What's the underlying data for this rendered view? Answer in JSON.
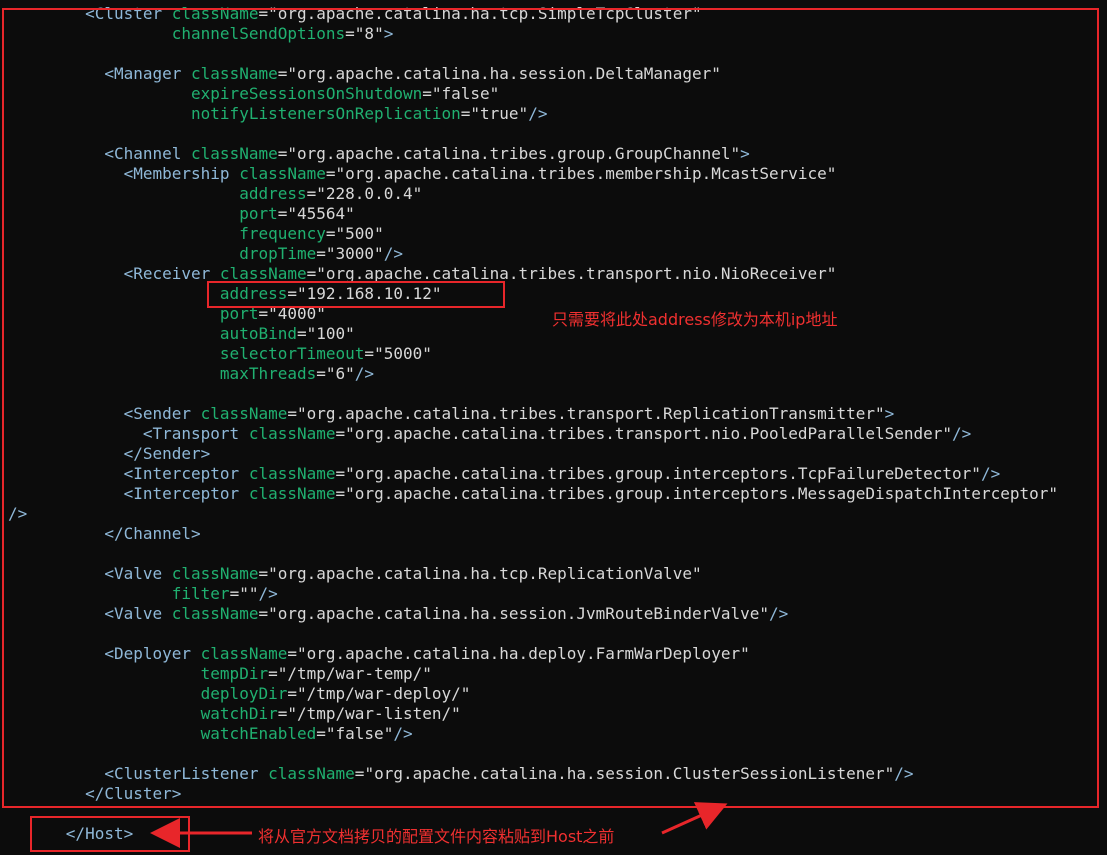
{
  "editor": {
    "lines": [
      [
        {
          "t": "tag",
          "s": "        <Cluster "
        },
        {
          "t": "attr",
          "s": "className"
        },
        {
          "t": "eq",
          "s": "="
        },
        {
          "t": "val",
          "s": "\"org.apache.catalina.ha.tcp.SimpleTcpCluster\""
        }
      ],
      [
        {
          "t": "attr",
          "s": "                 channelSendOptions"
        },
        {
          "t": "eq",
          "s": "="
        },
        {
          "t": "val",
          "s": "\"8\""
        },
        {
          "t": "tag",
          "s": ">"
        }
      ],
      [],
      [
        {
          "t": "tag",
          "s": "          <Manager "
        },
        {
          "t": "attr",
          "s": "className"
        },
        {
          "t": "eq",
          "s": "="
        },
        {
          "t": "val",
          "s": "\"org.apache.catalina.ha.session.DeltaManager\""
        }
      ],
      [
        {
          "t": "attr",
          "s": "                   expireSessionsOnShutdown"
        },
        {
          "t": "eq",
          "s": "="
        },
        {
          "t": "val",
          "s": "\"false\""
        }
      ],
      [
        {
          "t": "attr",
          "s": "                   notifyListenersOnReplication"
        },
        {
          "t": "eq",
          "s": "="
        },
        {
          "t": "val",
          "s": "\"true\""
        },
        {
          "t": "tag",
          "s": "/>"
        }
      ],
      [],
      [
        {
          "t": "tag",
          "s": "          <Channel "
        },
        {
          "t": "attr",
          "s": "className"
        },
        {
          "t": "eq",
          "s": "="
        },
        {
          "t": "val",
          "s": "\"org.apache.catalina.tribes.group.GroupChannel\""
        },
        {
          "t": "tag",
          "s": ">"
        }
      ],
      [
        {
          "t": "tag",
          "s": "            <Membership "
        },
        {
          "t": "attr",
          "s": "className"
        },
        {
          "t": "eq",
          "s": "="
        },
        {
          "t": "val",
          "s": "\"org.apache.catalina.tribes.membership.McastService\""
        }
      ],
      [
        {
          "t": "attr",
          "s": "                        address"
        },
        {
          "t": "eq",
          "s": "="
        },
        {
          "t": "val",
          "s": "\"228.0.0.4\""
        }
      ],
      [
        {
          "t": "attr",
          "s": "                        port"
        },
        {
          "t": "eq",
          "s": "="
        },
        {
          "t": "val",
          "s": "\"45564\""
        }
      ],
      [
        {
          "t": "attr",
          "s": "                        frequency"
        },
        {
          "t": "eq",
          "s": "="
        },
        {
          "t": "val",
          "s": "\"500\""
        }
      ],
      [
        {
          "t": "attr",
          "s": "                        dropTime"
        },
        {
          "t": "eq",
          "s": "="
        },
        {
          "t": "val",
          "s": "\"3000\""
        },
        {
          "t": "tag",
          "s": "/>"
        }
      ],
      [
        {
          "t": "tag",
          "s": "            <Receiver "
        },
        {
          "t": "attr",
          "s": "className"
        },
        {
          "t": "eq",
          "s": "="
        },
        {
          "t": "val",
          "s": "\"org.apache.catalina.tribes.transport.nio.NioReceiver\""
        }
      ],
      [
        {
          "t": "attr",
          "s": "                      address"
        },
        {
          "t": "eq",
          "s": "="
        },
        {
          "t": "val",
          "s": "\"192.168.10.12\""
        }
      ],
      [
        {
          "t": "attr",
          "s": "                      port"
        },
        {
          "t": "eq",
          "s": "="
        },
        {
          "t": "val",
          "s": "\"4000\""
        }
      ],
      [
        {
          "t": "attr",
          "s": "                      autoBind"
        },
        {
          "t": "eq",
          "s": "="
        },
        {
          "t": "val",
          "s": "\"100\""
        }
      ],
      [
        {
          "t": "attr",
          "s": "                      selectorTimeout"
        },
        {
          "t": "eq",
          "s": "="
        },
        {
          "t": "val",
          "s": "\"5000\""
        }
      ],
      [
        {
          "t": "attr",
          "s": "                      maxThreads"
        },
        {
          "t": "eq",
          "s": "="
        },
        {
          "t": "val",
          "s": "\"6\""
        },
        {
          "t": "tag",
          "s": "/>"
        }
      ],
      [],
      [
        {
          "t": "tag",
          "s": "            <Sender "
        },
        {
          "t": "attr",
          "s": "className"
        },
        {
          "t": "eq",
          "s": "="
        },
        {
          "t": "val",
          "s": "\"org.apache.catalina.tribes.transport.ReplicationTransmitter\""
        },
        {
          "t": "tag",
          "s": ">"
        }
      ],
      [
        {
          "t": "tag",
          "s": "              <Transport "
        },
        {
          "t": "attr",
          "s": "className"
        },
        {
          "t": "eq",
          "s": "="
        },
        {
          "t": "val",
          "s": "\"org.apache.catalina.tribes.transport.nio.PooledParallelSender\""
        },
        {
          "t": "tag",
          "s": "/>"
        }
      ],
      [
        {
          "t": "tag",
          "s": "            </Sender>"
        }
      ],
      [
        {
          "t": "tag",
          "s": "            <Interceptor "
        },
        {
          "t": "attr",
          "s": "className"
        },
        {
          "t": "eq",
          "s": "="
        },
        {
          "t": "val",
          "s": "\"org.apache.catalina.tribes.group.interceptors.TcpFailureDetector\""
        },
        {
          "t": "tag",
          "s": "/>"
        }
      ],
      [
        {
          "t": "tag",
          "s": "            <Interceptor "
        },
        {
          "t": "attr",
          "s": "className"
        },
        {
          "t": "eq",
          "s": "="
        },
        {
          "t": "val",
          "s": "\"org.apache.catalina.tribes.group.interceptors.MessageDispatchInterceptor\""
        }
      ],
      [
        {
          "t": "tag",
          "s": "/>"
        }
      ],
      [
        {
          "t": "tag",
          "s": "          </Channel>"
        }
      ],
      [],
      [
        {
          "t": "tag",
          "s": "          <Valve "
        },
        {
          "t": "attr",
          "s": "className"
        },
        {
          "t": "eq",
          "s": "="
        },
        {
          "t": "val",
          "s": "\"org.apache.catalina.ha.tcp.ReplicationValve\""
        }
      ],
      [
        {
          "t": "attr",
          "s": "                 filter"
        },
        {
          "t": "eq",
          "s": "="
        },
        {
          "t": "val",
          "s": "\"\""
        },
        {
          "t": "tag",
          "s": "/>"
        }
      ],
      [
        {
          "t": "tag",
          "s": "          <Valve "
        },
        {
          "t": "attr",
          "s": "className"
        },
        {
          "t": "eq",
          "s": "="
        },
        {
          "t": "val",
          "s": "\"org.apache.catalina.ha.session.JvmRouteBinderValve\""
        },
        {
          "t": "tag",
          "s": "/>"
        }
      ],
      [],
      [
        {
          "t": "tag",
          "s": "          <Deployer "
        },
        {
          "t": "attr",
          "s": "className"
        },
        {
          "t": "eq",
          "s": "="
        },
        {
          "t": "val",
          "s": "\"org.apache.catalina.ha.deploy.FarmWarDeployer\""
        }
      ],
      [
        {
          "t": "attr",
          "s": "                    tempDir"
        },
        {
          "t": "eq",
          "s": "="
        },
        {
          "t": "val",
          "s": "\"/tmp/war-temp/\""
        }
      ],
      [
        {
          "t": "attr",
          "s": "                    deployDir"
        },
        {
          "t": "eq",
          "s": "="
        },
        {
          "t": "val",
          "s": "\"/tmp/war-deploy/\""
        }
      ],
      [
        {
          "t": "attr",
          "s": "                    watchDir"
        },
        {
          "t": "eq",
          "s": "="
        },
        {
          "t": "val",
          "s": "\"/tmp/war-listen/\""
        }
      ],
      [
        {
          "t": "attr",
          "s": "                    watchEnabled"
        },
        {
          "t": "eq",
          "s": "="
        },
        {
          "t": "val",
          "s": "\"false\""
        },
        {
          "t": "tag",
          "s": "/>"
        }
      ],
      [],
      [
        {
          "t": "tag",
          "s": "          <ClusterListener "
        },
        {
          "t": "attr",
          "s": "className"
        },
        {
          "t": "eq",
          "s": "="
        },
        {
          "t": "val",
          "s": "\"org.apache.catalina.ha.session.ClusterSessionListener\""
        },
        {
          "t": "tag",
          "s": "/>"
        }
      ],
      [
        {
          "t": "tag",
          "s": "        </Cluster>"
        }
      ],
      [],
      [
        {
          "t": "tag",
          "s": "      </Host>"
        }
      ]
    ]
  },
  "annotations": {
    "address_note": "只需要将此处address修改为本机ip地址",
    "host_note": "将从官方文档拷贝的配置文件内容粘贴到Host之前"
  },
  "colors": {
    "background": "#0c0c0c",
    "tag": "#8fb8d8",
    "attribute": "#20b070",
    "value": "#d8d8d8",
    "annotation": "#e8262a"
  }
}
